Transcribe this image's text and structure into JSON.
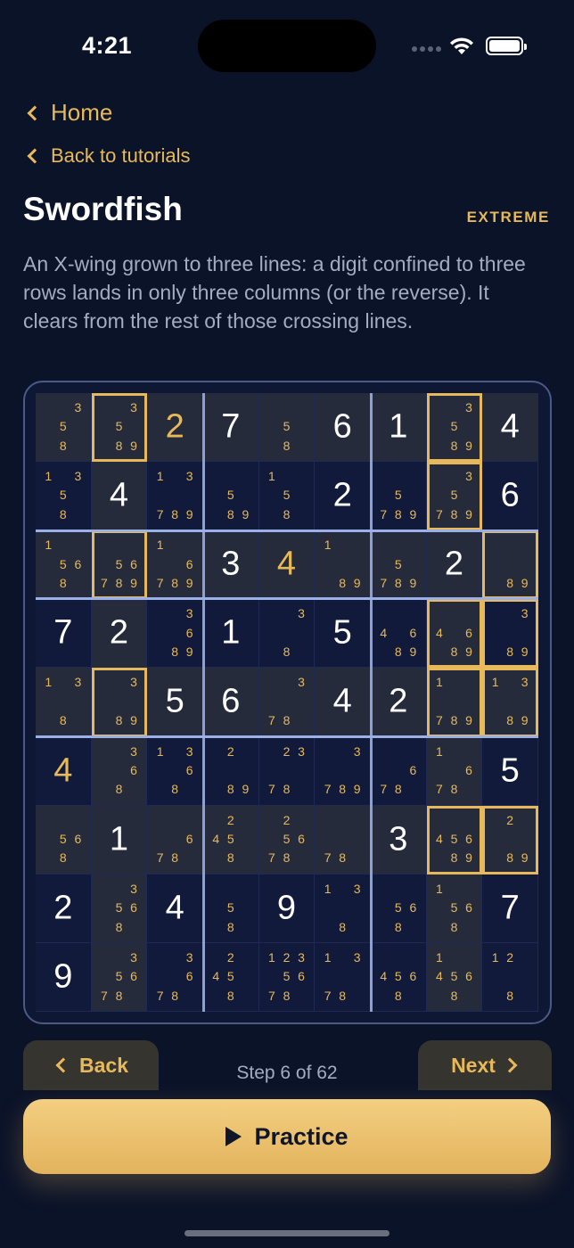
{
  "status": {
    "time": "4:21"
  },
  "nav": {
    "home_label": "Home",
    "back_label": "Back to tutorials"
  },
  "header": {
    "title": "Swordfish",
    "difficulty": "EXTREME"
  },
  "description": "An X-wing grown to three lines: a digit confined to three rows lands in only three columns (or the reverse). It clears from the rest of those crossing lines.",
  "board": {
    "cells": [
      [
        {
          "c": [
            3,
            5,
            8
          ]
        },
        {
          "c": [
            3,
            5,
            8,
            9
          ]
        },
        {
          "v": 2,
          "gold": true
        },
        {
          "v": 7
        },
        {
          "c": [
            5,
            8
          ]
        },
        {
          "v": 6
        },
        {
          "v": 1
        },
        {
          "c": [
            3,
            5,
            8,
            9
          ]
        },
        {
          "v": 4
        }
      ],
      [
        {
          "c": [
            1,
            3,
            5,
            8
          ]
        },
        {
          "v": 4
        },
        {
          "c": [
            1,
            3,
            7,
            8,
            9
          ]
        },
        {
          "c": [
            5,
            8,
            9
          ]
        },
        {
          "c": [
            1,
            5,
            8
          ]
        },
        {
          "v": 2
        },
        {
          "c": [
            5,
            7,
            8,
            9
          ]
        },
        {
          "c": [
            3,
            5,
            7,
            8,
            9
          ]
        },
        {
          "v": 6
        }
      ],
      [
        {
          "c": [
            1,
            5,
            6,
            8
          ]
        },
        {
          "c": [
            5,
            6,
            7,
            8,
            9
          ]
        },
        {
          "c": [
            1,
            6,
            7,
            8,
            9
          ]
        },
        {
          "v": 3
        },
        {
          "v": 4,
          "gold": true
        },
        {
          "c": [
            1,
            8,
            9
          ]
        },
        {
          "c": [
            5,
            7,
            8,
            9
          ]
        },
        {
          "v": 2
        },
        {
          "c": [
            8,
            9
          ]
        }
      ],
      [
        {
          "v": 7
        },
        {
          "v": 2
        },
        {
          "c": [
            3,
            6,
            8,
            9
          ]
        },
        {
          "v": 1
        },
        {
          "c": [
            3,
            8
          ]
        },
        {
          "v": 5
        },
        {
          "c": [
            4,
            6,
            8,
            9
          ]
        },
        {
          "c": [
            4,
            6,
            8,
            9
          ]
        },
        {
          "c": [
            3,
            8,
            9
          ]
        }
      ],
      [
        {
          "c": [
            1,
            3,
            8
          ]
        },
        {
          "c": [
            3,
            8,
            9
          ]
        },
        {
          "v": 5
        },
        {
          "v": 6
        },
        {
          "c": [
            3,
            7,
            8
          ]
        },
        {
          "v": 4
        },
        {
          "v": 2
        },
        {
          "c": [
            1,
            7,
            8,
            9
          ]
        },
        {
          "c": [
            1,
            3,
            8,
            9
          ]
        }
      ],
      [
        {
          "v": 4,
          "gold": true
        },
        {
          "c": [
            3,
            6,
            8
          ]
        },
        {
          "c": [
            1,
            3,
            6,
            8
          ]
        },
        {
          "c": [
            2,
            8,
            9
          ]
        },
        {
          "c": [
            2,
            3,
            7,
            8
          ]
        },
        {
          "c": [
            3,
            7,
            8,
            9
          ]
        },
        {
          "c": [
            6,
            7,
            8
          ]
        },
        {
          "c": [
            1,
            6,
            7,
            8
          ]
        },
        {
          "v": 5
        }
      ],
      [
        {
          "c": [
            5,
            6,
            8
          ]
        },
        {
          "v": 1
        },
        {
          "c": [
            6,
            7,
            8
          ]
        },
        {
          "c": [
            2,
            4,
            5,
            8
          ]
        },
        {
          "c": [
            2,
            5,
            6,
            7,
            8
          ]
        },
        {
          "c": [
            7,
            8
          ]
        },
        {
          "v": 3
        },
        {
          "c": [
            4,
            5,
            6,
            8,
            9
          ]
        },
        {
          "c": [
            2,
            8,
            9
          ]
        }
      ],
      [
        {
          "v": 2
        },
        {
          "c": [
            3,
            5,
            6,
            8
          ]
        },
        {
          "v": 4
        },
        {
          "c": [
            5,
            8
          ]
        },
        {
          "v": 9
        },
        {
          "c": [
            1,
            3,
            8
          ]
        },
        {
          "c": [
            5,
            6,
            8
          ]
        },
        {
          "c": [
            1,
            5,
            6,
            8
          ]
        },
        {
          "v": 7
        }
      ],
      [
        {
          "v": 9
        },
        {
          "c": [
            3,
            5,
            6,
            7,
            8
          ]
        },
        {
          "c": [
            3,
            6,
            7,
            8
          ]
        },
        {
          "c": [
            2,
            4,
            5,
            8
          ]
        },
        {
          "c": [
            1,
            2,
            3,
            5,
            6,
            7,
            8
          ]
        },
        {
          "c": [
            1,
            3,
            7,
            8
          ]
        },
        {
          "c": [
            4,
            5,
            6,
            8
          ]
        },
        {
          "c": [
            1,
            4,
            5,
            6,
            8
          ]
        },
        {
          "c": [
            1,
            2,
            8
          ]
        }
      ]
    ],
    "shade_rows": [
      0,
      2,
      4,
      6
    ],
    "shade_cols": [
      1,
      7
    ],
    "highlighted": [
      [
        0,
        1
      ],
      [
        0,
        7
      ],
      [
        1,
        7
      ],
      [
        2,
        1
      ],
      [
        2,
        8
      ],
      [
        3,
        7
      ],
      [
        3,
        8
      ],
      [
        4,
        1
      ],
      [
        4,
        7
      ],
      [
        4,
        8
      ],
      [
        6,
        7
      ],
      [
        6,
        8
      ]
    ],
    "highlight_rows": [
      2,
      4
    ]
  },
  "footer": {
    "back_label": "Back",
    "step_text": "Step 6 of 62",
    "next_label": "Next",
    "practice_label": "Practice"
  },
  "colors": {
    "accent": "#e8b95a",
    "background": "#0b1329",
    "text_muted": "#a3acc0"
  }
}
